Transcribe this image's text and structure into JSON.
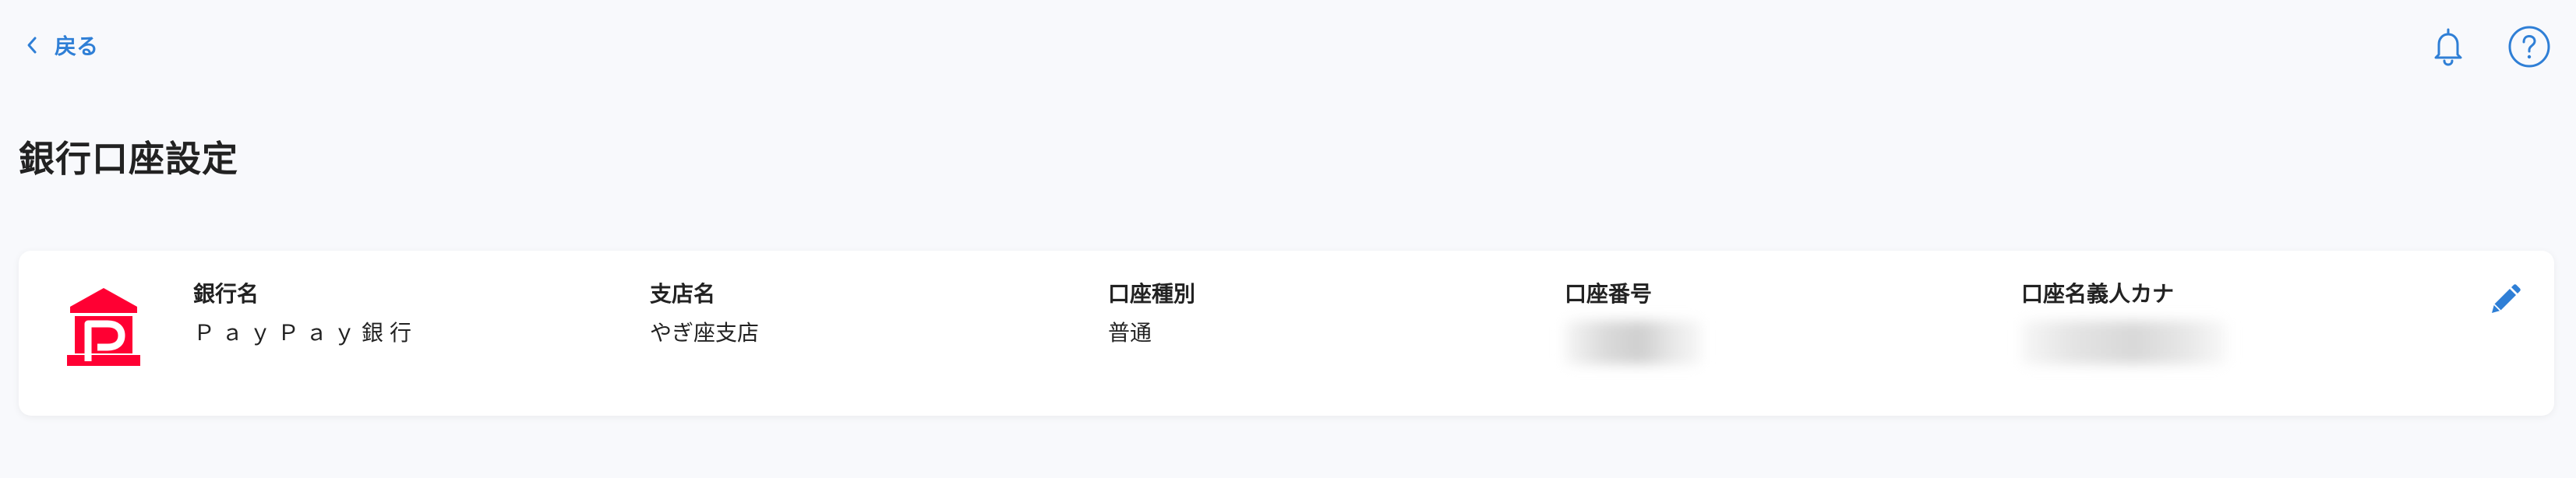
{
  "header": {
    "back_label": "戻る",
    "icons": [
      "chevron-left-icon",
      "bell-icon",
      "help-icon"
    ],
    "accent_color": "#2f7fd6"
  },
  "page": {
    "title": "銀行口座設定"
  },
  "account": {
    "logo": "paypay-bank-logo",
    "brand_color": "#ff0033",
    "fields": {
      "bank_name": {
        "label": "銀行名",
        "value": "ＰａｙＰａｙ銀行"
      },
      "branch_name": {
        "label": "支店名",
        "value": "やぎ座支店"
      },
      "account_type": {
        "label": "口座種別",
        "value": "普通"
      },
      "account_number": {
        "label": "口座番号",
        "value": ""
      },
      "account_holder_kana": {
        "label": "口座名義人カナ",
        "value": ""
      }
    },
    "edit_icon": "pencil-icon"
  }
}
